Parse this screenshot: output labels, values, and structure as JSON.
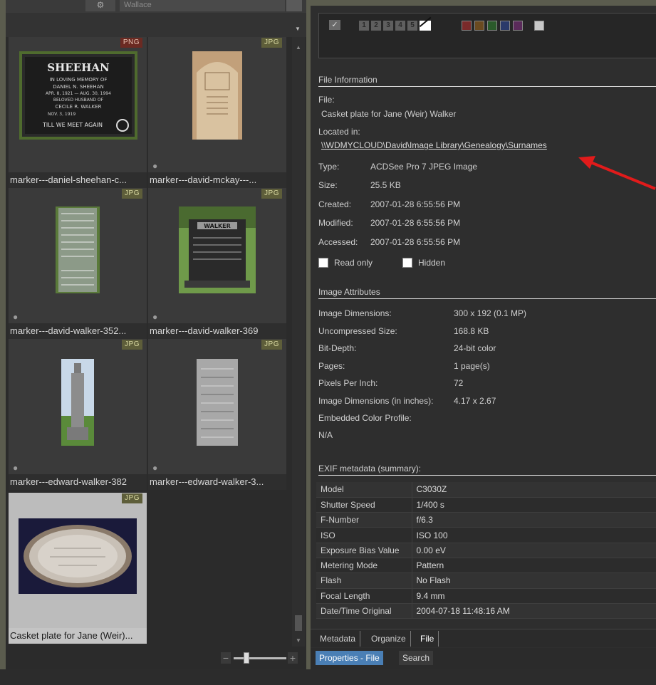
{
  "left": {
    "search_placeholder": "Wallace",
    "gear_glyph": "⚙",
    "thumbnails": [
      {
        "name": "marker---daniel-sheehan-c...",
        "type": "PNG"
      },
      {
        "name": "marker---david-mckay---...",
        "type": "JPG"
      },
      {
        "name": "marker---david-walker-352...",
        "type": "JPG"
      },
      {
        "name": "marker---david-walker-369",
        "type": "JPG"
      },
      {
        "name": "marker---edward-walker-382",
        "type": "JPG"
      },
      {
        "name": "marker---edward-walker-3...",
        "type": "JPG"
      },
      {
        "name": "Casket plate for Jane (Weir)...",
        "type": "JPG"
      }
    ],
    "sheehan_text": {
      "title": "SHEEHAN",
      "line1": "IN LOVING MEMORY OF",
      "line2": "DANIEL N. SHEEHAN",
      "line3": "APR. 8, 1921 — AUG. 30, 1994",
      "line4": "BELOVED HUSBAND OF",
      "line5": "CECILE R. WALKER",
      "line6": "NOV. 3, 1919",
      "line7": "TILL WE MEET AGAIN"
    },
    "walker_plaque": "WALKER",
    "zoom_minus": "−",
    "zoom_plus": "+"
  },
  "rating": {
    "check": "✓",
    "numbers": [
      "1",
      "2",
      "3",
      "4",
      "5"
    ],
    "label_colors": [
      "#7a2a2a",
      "#6a4a20",
      "#2a5a2a",
      "#2a3a6a",
      "#5a2a5a",
      "#c8c8c8"
    ]
  },
  "file_info": {
    "header": "File Information",
    "file_label": "File:",
    "file_value": "Casket plate for Jane (Weir) Walker",
    "located_label": "Located in:",
    "located_value": "\\\\WDMYCLOUD\\David\\Image Library\\Genealogy\\Surnames",
    "type_label": "Type:",
    "type_value": "ACDSee Pro 7 JPEG Image",
    "size_label": "Size:",
    "size_value": "25.5 KB",
    "created_label": "Created:",
    "created_value": "2007-01-28 6:55:56 PM",
    "modified_label": "Modified:",
    "modified_value": "2007-01-28 6:55:56 PM",
    "accessed_label": "Accessed:",
    "accessed_value": "2007-01-28 6:55:56 PM",
    "readonly_label": "Read only",
    "hidden_label": "Hidden"
  },
  "image_attributes": {
    "header": "Image Attributes",
    "rows": [
      {
        "k": "Image Dimensions:",
        "v": "300 x 192 (0.1 MP)"
      },
      {
        "k": "Uncompressed Size:",
        "v": "168.8 KB"
      },
      {
        "k": "Bit-Depth:",
        "v": "24-bit color"
      },
      {
        "k": "Pages:",
        "v": "1 page(s)"
      },
      {
        "k": "Pixels Per Inch:",
        "v": "72"
      },
      {
        "k": "Image Dimensions (in inches):",
        "v": "4.17 x 2.67"
      },
      {
        "k": "Embedded Color Profile:",
        "v": ""
      }
    ],
    "profile_value": "N/A"
  },
  "exif": {
    "header": "EXIF metadata (summary):",
    "rows": [
      {
        "k": "Model",
        "v": "C3030Z"
      },
      {
        "k": "Shutter Speed",
        "v": "1/400 s"
      },
      {
        "k": "F-Number",
        "v": "f/6.3"
      },
      {
        "k": "ISO",
        "v": "ISO 100"
      },
      {
        "k": "Exposure Bias Value",
        "v": "0.00 eV"
      },
      {
        "k": "Metering Mode",
        "v": "Pattern"
      },
      {
        "k": "Flash",
        "v": "No Flash"
      },
      {
        "k": "Focal Length",
        "v": "9.4 mm"
      },
      {
        "k": "Date/Time Original",
        "v": "2004-07-18 11:48:16 AM"
      }
    ]
  },
  "tabs": {
    "metadata": "Metadata",
    "organize": "Organize",
    "file": "File"
  },
  "bottom_tabs": {
    "properties": "Properties - File",
    "search": "Search"
  },
  "colors": {
    "accent_tab": "#4a7fb5",
    "annotation_arrow": "#e11b1b"
  }
}
